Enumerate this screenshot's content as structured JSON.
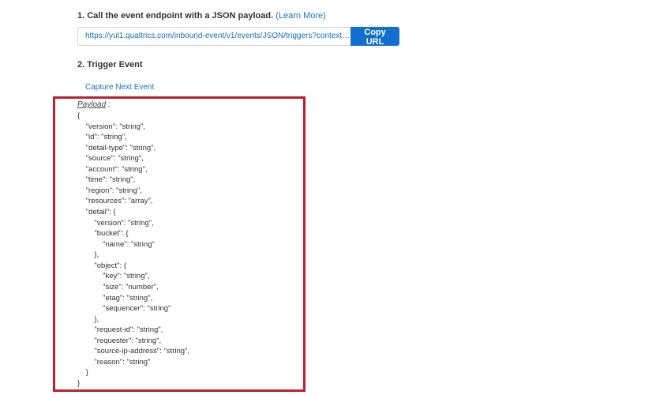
{
  "step1": {
    "title": "1. Call the event endpoint with a JSON payload.",
    "learn_more": "(Learn More)"
  },
  "url_field": {
    "value": "https://yul1.qualtrics.com/inbound-event/v1/events/JSON/triggers?contextI..."
  },
  "copy_button": "Copy URL",
  "step2": {
    "title": "2. Trigger Event"
  },
  "capture_link": "Capture Next Event",
  "payload": {
    "label": "Payload",
    "separator": " :",
    "lines": [
      {
        "text": "{",
        "indent": 0
      },
      {
        "text": "\"version\": \"string\",",
        "indent": 1
      },
      {
        "text": "\"id\": \"string\",",
        "indent": 1
      },
      {
        "text": "\"detail-type\": \"string\",",
        "indent": 1
      },
      {
        "text": "\"source\": \"string\",",
        "indent": 1
      },
      {
        "text": "\"account\": \"string\",",
        "indent": 1
      },
      {
        "text": "\"time\": \"string\",",
        "indent": 1
      },
      {
        "text": "\"region\": \"string\",",
        "indent": 1
      },
      {
        "text": "\"resources\": \"array\",",
        "indent": 1
      },
      {
        "text": "\"detail\": {",
        "indent": 1
      },
      {
        "text": "\"version\": \"string\",",
        "indent": 2
      },
      {
        "text": "\"bucket\": {",
        "indent": 2
      },
      {
        "text": "\"name\": \"string\"",
        "indent": 3
      },
      {
        "text": "},",
        "indent": 2
      },
      {
        "text": "\"object\": {",
        "indent": 2
      },
      {
        "text": "\"key\": \"string\",",
        "indent": 3
      },
      {
        "text": "\"size\": \"number\",",
        "indent": 3
      },
      {
        "text": "\"etag\": \"string\",",
        "indent": 3
      },
      {
        "text": "\"sequencer\": \"string\"",
        "indent": 3
      },
      {
        "text": "},",
        "indent": 2
      },
      {
        "text": "\"request-id\": \"string\",",
        "indent": 2
      },
      {
        "text": "\"requester\": \"string\",",
        "indent": 2
      },
      {
        "text": "\"source-ip-address\": \"string\",",
        "indent": 2
      },
      {
        "text": "\"reason\": \"string\"",
        "indent": 2
      },
      {
        "text": "}",
        "indent": 1
      },
      {
        "text": "}",
        "indent": 0
      }
    ]
  },
  "colors": {
    "accent": "#1170cf",
    "link": "#1a73c9",
    "highlight": "#c11f30"
  }
}
